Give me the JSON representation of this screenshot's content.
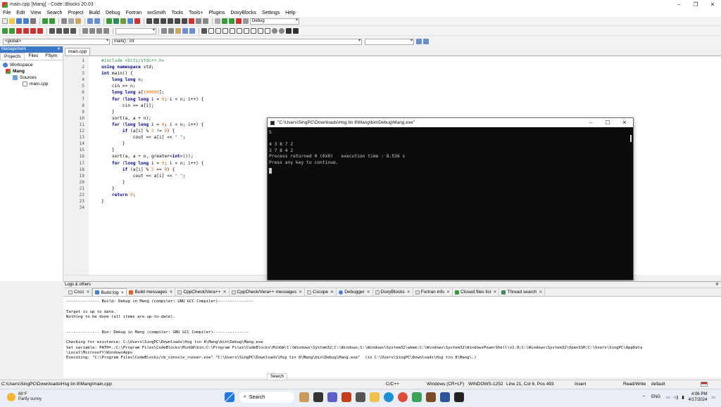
{
  "window": {
    "title": "main.cpp [Mang] - Code::Blocks 20.03"
  },
  "menu": [
    "File",
    "Edit",
    "View",
    "Search",
    "Project",
    "Build",
    "Debug",
    "Fortran",
    "wxSmith",
    "Tools",
    "Tools+",
    "Plugins",
    "DoxyBlocks",
    "Settings",
    "Help"
  ],
  "toolbar": {
    "build_target": "Debug"
  },
  "symbols": {
    "scope": "<global>",
    "function": "main() : int"
  },
  "management": {
    "title": "Management",
    "tabs": [
      "Projects",
      "Files",
      "FSym"
    ],
    "tree": [
      "Workspace",
      "Mang",
      "Sources",
      "main.cpp"
    ]
  },
  "editor": {
    "tab": "main.cpp",
    "lines": [
      "#include <bits/stdc++.h>",
      "using namespace std;",
      "int main() {",
      "    long long n;",
      "    cin >> n;",
      "    long long a[100000];",
      "    for (long long i = 0; i < n; i++) {",
      "        cin >> a[i];",
      "    }",
      "    sort(a, a + n);",
      "    for (long long i = 0; i < n; i++) {",
      "        if (a[i] % 2 != 0) {",
      "            cout << a[i] << \" \";",
      "        }",
      "    }",
      "    sort(a, a + n, greater<int>());",
      "    for (long long i = 0; i < n; i++) {",
      "        if (a[i] % 2 == 0) {",
      "            cout << a[i] << \" \";",
      "        }",
      "    }",
      "    return 0;",
      "}",
      ""
    ]
  },
  "console": {
    "title": "\"C:\\Users\\SingPC\\Downloads\\Hsg tin 8\\Mang\\bin\\Debug\\Mang.exe\"",
    "lines": [
      "5",
      "",
      "4 3 8 7 2",
      "3 7 8 4 2",
      "Process returned 0 (0x0)   execution time : 8.536 s",
      "Press any key to continue."
    ]
  },
  "logs": {
    "title": "Logs & others",
    "tabs": [
      "Cccc",
      "Build log",
      "Build messages",
      "CppCheck/Vera++",
      "CppCheck/Vera++ messages",
      "Cscope",
      "Debugger",
      "DoxyBlocks",
      "Fortran info",
      "Closed files list",
      "Thread search"
    ],
    "active_tab": "Build log",
    "lines": [
      "-------------- Build: Debug in Mang (compiler: GNU GCC Compiler)---------------",
      "",
      "Target is up to date.",
      "Nothing to be done (all items are up-to-date).",
      "",
      "",
      "-------------- Run: Debug in Mang (compiler: GNU GCC Compiler)---------------",
      "",
      "Checking for existence: C:\\Users\\SingPC\\Downloads\\Hsg tin 8\\Mang\\bin\\Debug\\Mang.exe",
      "Set variable: PATH=.;C:\\Program Files\\CodeBlocks\\MinGW\\bin;C:\\Program Files\\CodeBlocks\\MinGW;C:\\Windows\\System32;C:\\Windows;C:\\Windows\\System32\\wbem;C:\\Windows\\System32\\WindowsPowerShell\\v1.0;C:\\Windows\\System32\\OpenSSH;C:\\Users\\SingPC\\AppData",
      "\\Local\\Microsoft\\WindowsApps",
      "Executing: \"C:\\Program Files\\CodeBlocks/cb_console_runner.exe\" \"C:\\Users\\SingPC\\Downloads\\Hsg tin 8\\Mang\\bin\\Debug\\Mang.exe\"  (in C:\\Users\\SingPC\\Downloads\\Hsg tin 8\\Mang\\.)"
    ]
  },
  "status": {
    "path": "C:\\Users\\SingPC\\Downloads\\Hsg tin 8\\Mang\\main.cpp",
    "lang": "C/C++",
    "eol": "Windows (CR+LF)",
    "encoding": "WINDOWS-1252",
    "position": "Line 21, Col 6, Pos 493",
    "mode": "Insert",
    "access": "Read/Write",
    "profile": "default"
  },
  "tooltip": "Search",
  "taskbar": {
    "weather_temp": "86°F",
    "weather_desc": "Partly sunny",
    "search": "Search",
    "lang": "ENG",
    "time": "4:06 PM",
    "date": "4/17/2024"
  }
}
